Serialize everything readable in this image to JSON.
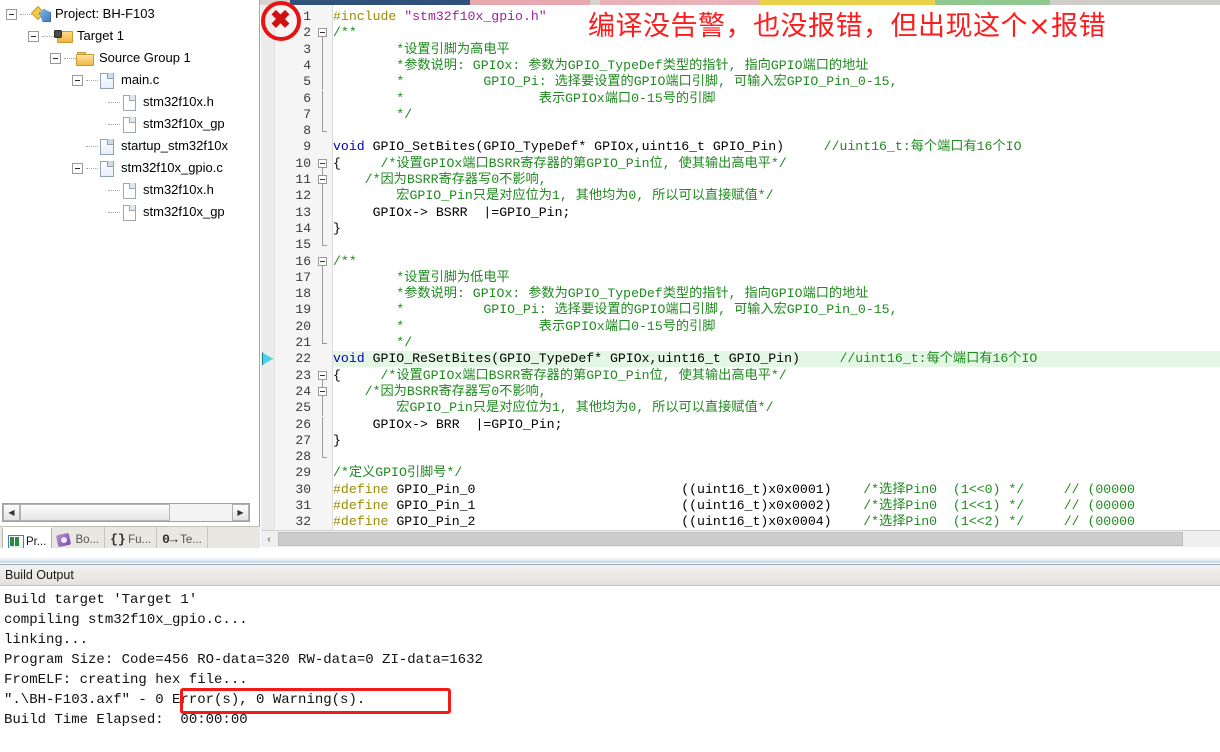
{
  "window": {
    "build_output_title": "Build Output"
  },
  "project_tree": {
    "nodes": [
      {
        "label": "Project: BH-F103",
        "icon": "project-icon",
        "depth": 0,
        "expander": "minus"
      },
      {
        "label": "Target 1",
        "icon": "target-icon",
        "depth": 1,
        "expander": "minus"
      },
      {
        "label": "Source Group 1",
        "icon": "folder-icon",
        "depth": 2,
        "expander": "minus"
      },
      {
        "label": "main.c",
        "icon": "c-source-icon",
        "depth": 3,
        "expander": "minus"
      },
      {
        "label": "stm32f10x.h",
        "icon": "header-file-icon",
        "depth": 4,
        "expander": "none"
      },
      {
        "label": "stm32f10x_gp",
        "icon": "header-file-icon",
        "depth": 4,
        "expander": "none"
      },
      {
        "label": "startup_stm32f10x",
        "icon": "c-source-icon",
        "depth": 3,
        "expander": "none"
      },
      {
        "label": "stm32f10x_gpio.c",
        "icon": "c-source-icon",
        "depth": 3,
        "expander": "minus"
      },
      {
        "label": "stm32f10x.h",
        "icon": "header-file-icon",
        "depth": 4,
        "expander": "none"
      },
      {
        "label": "stm32f10x_gp",
        "icon": "header-file-icon",
        "depth": 4,
        "expander": "none"
      }
    ]
  },
  "panel_tabs": [
    {
      "label": "Pr...",
      "glyph": "project-window-icon",
      "active": true
    },
    {
      "label": "Bo...",
      "glyph": "books-icon",
      "active": false
    },
    {
      "label": "Fu...",
      "glyph": "functions-braces-icon",
      "active": false
    },
    {
      "label": "Te...",
      "glyph": "templates-icon",
      "active": false
    }
  ],
  "editor": {
    "scroll_left_arrow": "‹",
    "lines": [
      {
        "n": 1,
        "fold": "none",
        "spans": [
          {
            "t": "#include ",
            "c": "pre"
          },
          {
            "t": "\"stm32f10x_gpio.h\"",
            "c": "str"
          }
        ]
      },
      {
        "n": 2,
        "fold": "start",
        "spans": [
          {
            "t": "/**",
            "c": "cmt"
          }
        ]
      },
      {
        "n": 3,
        "fold": "bar",
        "spans": [
          {
            "t": "        *设置引脚为高电平",
            "c": "cmt"
          }
        ]
      },
      {
        "n": 4,
        "fold": "bar",
        "spans": [
          {
            "t": "        *参数说明: GPIOx: 参数为GPIO_TypeDef类型的指针, 指向GPIO端口的地址",
            "c": "cmt"
          }
        ]
      },
      {
        "n": 5,
        "fold": "bar",
        "spans": [
          {
            "t": "        *          GPIO_Pi: 选择要设置的GPIO端口引脚, 可输入宏GPIO_Pin_0-15,",
            "c": "cmt"
          }
        ]
      },
      {
        "n": 6,
        "fold": "bar",
        "spans": [
          {
            "t": "        *                 表示GPIOx端口0-15号的引脚",
            "c": "cmt"
          }
        ]
      },
      {
        "n": 7,
        "fold": "bar",
        "spans": [
          {
            "t": "        */",
            "c": "cmt"
          }
        ]
      },
      {
        "n": 8,
        "fold": "end",
        "spans": [
          {
            "t": "",
            "c": "plain"
          }
        ]
      },
      {
        "n": 9,
        "fold": "none",
        "spans": [
          {
            "t": "void",
            "c": "kw"
          },
          {
            "t": " GPIO_SetBites(GPIO_TypeDef* GPIOx,uint16_t GPIO_Pin)     ",
            "c": "plain"
          },
          {
            "t": "//uint16_t:每个端口有16个IO",
            "c": "cmt"
          }
        ]
      },
      {
        "n": 10,
        "fold": "start",
        "spans": [
          {
            "t": "{",
            "c": "plain"
          },
          {
            "t": "     ",
            "c": "plain"
          },
          {
            "t": "/*设置GPIOx端口BSRR寄存器的第GPIO_Pin位, 使其输出高电平*/",
            "c": "cmt"
          }
        ]
      },
      {
        "n": 11,
        "fold": "start",
        "spans": [
          {
            "t": "    /*因为BSRR寄存器写0不影响,",
            "c": "cmt"
          }
        ]
      },
      {
        "n": 12,
        "fold": "bar",
        "spans": [
          {
            "t": "        宏GPIO_Pin只是对应位为1, 其他均为0, 所以可以直接赋值*/",
            "c": "cmt"
          }
        ]
      },
      {
        "n": 13,
        "fold": "bar",
        "spans": [
          {
            "t": "     GPIOx-> BSRR  |=GPIO_Pin;",
            "c": "plain"
          }
        ]
      },
      {
        "n": 14,
        "fold": "bar",
        "spans": [
          {
            "t": "}",
            "c": "plain"
          }
        ]
      },
      {
        "n": 15,
        "fold": "end",
        "spans": [
          {
            "t": "",
            "c": "plain"
          }
        ]
      },
      {
        "n": 16,
        "fold": "start",
        "spans": [
          {
            "t": "/**",
            "c": "cmt"
          }
        ]
      },
      {
        "n": 17,
        "fold": "bar",
        "spans": [
          {
            "t": "        *设置引脚为低电平",
            "c": "cmt"
          }
        ]
      },
      {
        "n": 18,
        "fold": "bar",
        "spans": [
          {
            "t": "        *参数说明: GPIOx: 参数为GPIO_TypeDef类型的指针, 指向GPIO端口的地址",
            "c": "cmt"
          }
        ]
      },
      {
        "n": 19,
        "fold": "bar",
        "spans": [
          {
            "t": "        *          GPIO_Pi: 选择要设置的GPIO端口引脚, 可输入宏GPIO_Pin_0-15,",
            "c": "cmt"
          }
        ]
      },
      {
        "n": 20,
        "fold": "bar",
        "spans": [
          {
            "t": "        *                 表示GPIOx端口0-15号的引脚",
            "c": "cmt"
          }
        ]
      },
      {
        "n": 21,
        "fold": "end",
        "spans": [
          {
            "t": "        */",
            "c": "cmt"
          }
        ]
      },
      {
        "n": 22,
        "fold": "none",
        "highlight": true,
        "bookmark": true,
        "spans": [
          {
            "t": "void",
            "c": "kw"
          },
          {
            "t": " GPIO_ReSetBites(GPIO_TypeDef* GPIOx,uint16_t GPIO_Pin)     ",
            "c": "plain"
          },
          {
            "t": "//uint16_t:每个端口有16个IO",
            "c": "cmt"
          }
        ]
      },
      {
        "n": 23,
        "fold": "start",
        "spans": [
          {
            "t": "{",
            "c": "plain"
          },
          {
            "t": "     ",
            "c": "plain"
          },
          {
            "t": "/*设置GPIOx端口BSRR寄存器的第GPIO_Pin位, 使其输出高电平*/",
            "c": "cmt"
          }
        ]
      },
      {
        "n": 24,
        "fold": "start",
        "spans": [
          {
            "t": "    /*因为BSRR寄存器写0不影响,",
            "c": "cmt"
          }
        ]
      },
      {
        "n": 25,
        "fold": "bar",
        "spans": [
          {
            "t": "        宏GPIO_Pin只是对应位为1, 其他均为0, 所以可以直接赋值*/",
            "c": "cmt"
          }
        ]
      },
      {
        "n": 26,
        "fold": "bar",
        "spans": [
          {
            "t": "     GPIOx-> BRR  |=GPIO_Pin;",
            "c": "plain"
          }
        ]
      },
      {
        "n": 27,
        "fold": "bar",
        "spans": [
          {
            "t": "}",
            "c": "plain"
          }
        ]
      },
      {
        "n": 28,
        "fold": "end",
        "spans": [
          {
            "t": "",
            "c": "plain"
          }
        ]
      },
      {
        "n": 29,
        "fold": "none",
        "spans": [
          {
            "t": "/*定义GPIO引脚号*/",
            "c": "cmt"
          }
        ]
      },
      {
        "n": 30,
        "fold": "none",
        "spans": [
          {
            "t": "#define",
            "c": "pre"
          },
          {
            "t": " GPIO_Pin_0                          ((uint16_t)x0x0001)    ",
            "c": "plain"
          },
          {
            "t": "/*选择Pin0  (1<<0) */",
            "c": "cmt"
          },
          {
            "t": "     ",
            "c": "plain"
          },
          {
            "t": "// (00000",
            "c": "cmt"
          }
        ]
      },
      {
        "n": 31,
        "fold": "none",
        "spans": [
          {
            "t": "#define",
            "c": "pre"
          },
          {
            "t": " GPIO_Pin_1                          ((uint16_t)x0x0002)    ",
            "c": "plain"
          },
          {
            "t": "/*选择Pin0  (1<<1) */",
            "c": "cmt"
          },
          {
            "t": "     ",
            "c": "plain"
          },
          {
            "t": "// (00000",
            "c": "cmt"
          }
        ]
      },
      {
        "n": 32,
        "fold": "none",
        "spans": [
          {
            "t": "#define",
            "c": "pre"
          },
          {
            "t": " GPIO_Pin_2                          ((uint16_t)x0x0004)    ",
            "c": "plain"
          },
          {
            "t": "/*选择Pin0  (1<<2) */",
            "c": "cmt"
          },
          {
            "t": "     ",
            "c": "plain"
          },
          {
            "t": "// (00000",
            "c": "cmt"
          }
        ]
      }
    ]
  },
  "build_output": {
    "lines": [
      "Build target 'Target 1'",
      "compiling stm32f10x_gpio.c...",
      "linking...",
      "Program Size: Code=456 RO-data=320 RW-data=0 ZI-data=1632",
      "FromELF: creating hex file...",
      "\".\\BH-F103.axf\" - 0 Error(s), 0 Warning(s).",
      "Build Time Elapsed:  00:00:00"
    ]
  },
  "annotations": {
    "note_text": "编译没告警，也没报错，但出现这个×报错",
    "error_marker_glyph": "✖",
    "note_color": "#fb1d1d",
    "circle_color": "#e81414",
    "box_color": "#f41a1a"
  }
}
